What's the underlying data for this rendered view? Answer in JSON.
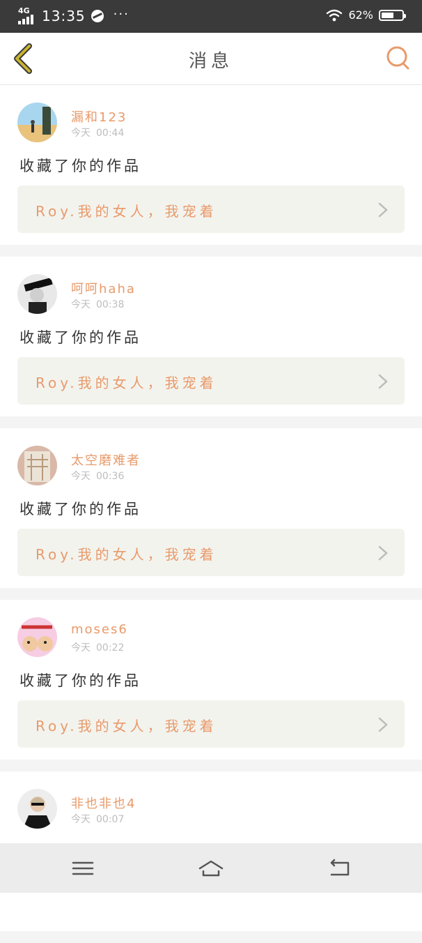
{
  "status_bar": {
    "network": "4G",
    "time": "13:35",
    "overflow": "···",
    "battery": "62%",
    "battery_level": 0.62,
    "icons": [
      "signal-icon",
      "browser-ball-icon",
      "wifi-icon",
      "battery-icon"
    ]
  },
  "header": {
    "title": "消息",
    "back_icon": "chevron-left-icon",
    "search_icon": "search-icon"
  },
  "messages": [
    {
      "name": "漏和123",
      "day": "今天",
      "time": "00:44",
      "action": "收藏了你的作品",
      "work_title": "Roy.我的女人，我宠着"
    },
    {
      "name": "呵呵haha",
      "day": "今天",
      "time": "00:38",
      "action": "收藏了你的作品",
      "work_title": "Roy.我的女人，我宠着"
    },
    {
      "name": "太空磨难者",
      "day": "今天",
      "time": "00:36",
      "action": "收藏了你的作品",
      "work_title": "Roy.我的女人，我宠着"
    },
    {
      "name": "moses6",
      "day": "今天",
      "time": "00:22",
      "action": "收藏了你的作品",
      "work_title": "Roy.我的女人，我宠着"
    },
    {
      "name": "非也非也4",
      "day": "今天",
      "time": "00:07"
    }
  ],
  "colors": {
    "accent": "#e89a6a",
    "back_icon": "#c9b430",
    "status_bar_bg": "#3a3a3a",
    "card_bg": "#ffffff",
    "work_bg": "#f3f3ee",
    "page_bg": "#f4f4f4"
  },
  "nav_bar": {
    "icons": [
      "menu-icon",
      "home-icon",
      "back-icon"
    ]
  }
}
